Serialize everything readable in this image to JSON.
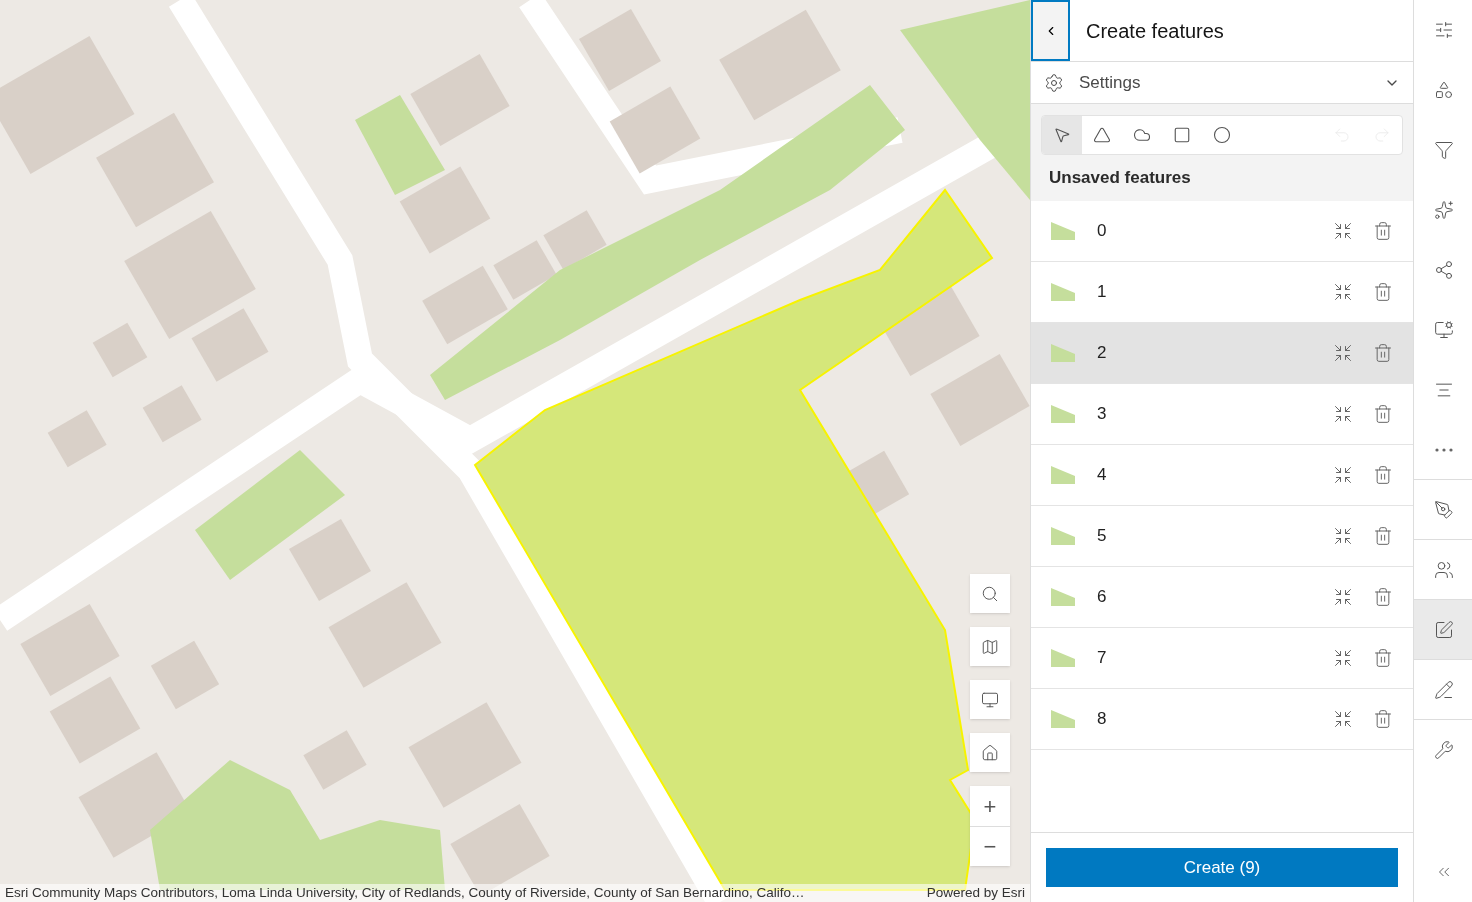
{
  "map": {
    "controls": [
      {
        "kind": "search"
      },
      {
        "kind": "basemap"
      },
      {
        "kind": "fullscreen"
      },
      {
        "kind": "home"
      }
    ],
    "zoom": [
      {
        "label": "+"
      },
      {
        "label": "−"
      }
    ],
    "attribution": "Esri Community Maps Contributors, Loma Linda University, City of Redlands, County of Riverside, County of San Bernardino, Califo…",
    "powered_by": "Powered by Esri"
  },
  "panel": {
    "title": "Create features",
    "settings": {
      "label": "Settings",
      "expanded": false
    },
    "tools": [
      {
        "kind": "select",
        "selected": true,
        "disabled": false
      },
      {
        "kind": "polygon",
        "selected": false,
        "disabled": false
      },
      {
        "kind": "freehand",
        "selected": false,
        "disabled": false
      },
      {
        "kind": "rectangle",
        "selected": false,
        "disabled": false
      },
      {
        "kind": "circle",
        "selected": false,
        "disabled": false
      },
      {
        "kind": "undo",
        "selected": false,
        "disabled": true
      },
      {
        "kind": "redo",
        "selected": false,
        "disabled": true
      }
    ],
    "section_title": "Unsaved features",
    "features": [
      {
        "label": "0",
        "selected": false
      },
      {
        "label": "1",
        "selected": false
      },
      {
        "label": "2",
        "selected": true
      },
      {
        "label": "3",
        "selected": false
      },
      {
        "label": "4",
        "selected": false
      },
      {
        "label": "5",
        "selected": false
      },
      {
        "label": "6",
        "selected": false
      },
      {
        "label": "7",
        "selected": false
      },
      {
        "label": "8",
        "selected": false
      }
    ],
    "create_button": "Create (9)"
  },
  "rail": [
    {
      "kind": "sliders",
      "selected": false,
      "divider": false
    },
    {
      "kind": "shapes",
      "selected": false,
      "divider": false
    },
    {
      "kind": "filter",
      "selected": false,
      "divider": false
    },
    {
      "kind": "sparkles",
      "selected": false,
      "divider": false
    },
    {
      "kind": "nodes",
      "selected": false,
      "divider": false
    },
    {
      "kind": "map-settings",
      "selected": false,
      "divider": false
    },
    {
      "kind": "list",
      "selected": false,
      "divider": false
    },
    {
      "kind": "more",
      "selected": false,
      "divider": true
    },
    {
      "kind": "pen-settings",
      "selected": false,
      "divider": true
    },
    {
      "kind": "group",
      "selected": false,
      "divider": true
    },
    {
      "kind": "edit",
      "selected": true,
      "divider": true
    },
    {
      "kind": "pen-line",
      "selected": false,
      "divider": true
    },
    {
      "kind": "wrench",
      "selected": false,
      "divider": false
    }
  ]
}
